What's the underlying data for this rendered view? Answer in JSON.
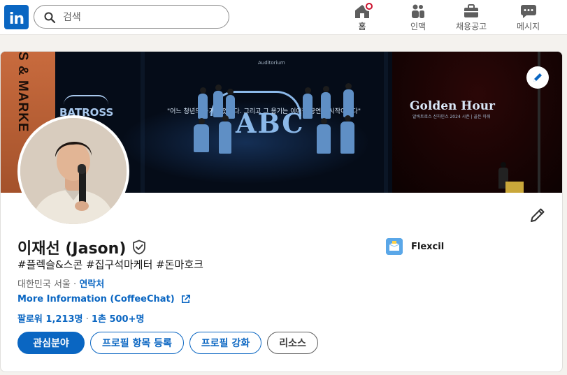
{
  "nav": {
    "logo_text": "in",
    "search_placeholder": "검색",
    "items": [
      {
        "label": "홈",
        "icon": "home-icon",
        "active": true,
        "notification": true
      },
      {
        "label": "인맥",
        "icon": "people-icon",
        "active": false
      },
      {
        "label": "채용공고",
        "icon": "briefcase-icon",
        "active": false
      },
      {
        "label": "메시지",
        "icon": "message-icon",
        "active": false
      }
    ]
  },
  "banner": {
    "left_text": "S & MARKE",
    "batross": "BATROSS",
    "abc": "ABC",
    "quote": "\"어느 청년의 용기가 있었다. 그리고 그 용기는 이어질 공연의 시작이었다\"",
    "auditorium": "Auditorium",
    "golden_hour": "Golden Hour",
    "golden_sub": "알바트로스 신하인스 2024 시즌 | 골든 아워"
  },
  "profile": {
    "name": "이재선 (Jason)",
    "headline": "#플렉슬&스콘 #집구석마케터 #돈마호크",
    "location": "대한민국 서울",
    "separator": " · ",
    "contact_label": "연락처",
    "more_info": "More Information (CoffeeChat)",
    "followers": "팔로워 1,213명",
    "connections": "1촌 500+명",
    "followers_sep": " · "
  },
  "company": {
    "name": "Flexcil"
  },
  "buttons": {
    "interests": "관심분야",
    "add_section": "프로필 항목 등록",
    "enhance": "프로필 강화",
    "resources": "리소스"
  },
  "colors": {
    "brand": "#0a66c2",
    "notification": "#cb112d"
  }
}
